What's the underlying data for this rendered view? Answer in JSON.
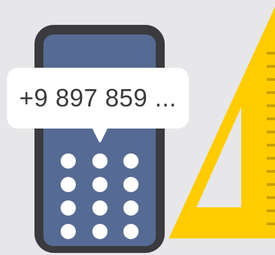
{
  "phone_number_bubble": {
    "text": "+9 897 859 ..."
  },
  "colors": {
    "background": "#e7e7e9",
    "phone_frame": "#3b3b3f",
    "phone_screen": "#566b93",
    "keypad_dots": "#ffffff",
    "ruler": "#ffcc00",
    "ruler_ticks": "#c9a000",
    "bubble": "#ffffff"
  },
  "icons": {
    "phone": "mobile-phone-icon",
    "keypad": "keypad-icon",
    "ruler": "set-square-ruler-icon"
  }
}
